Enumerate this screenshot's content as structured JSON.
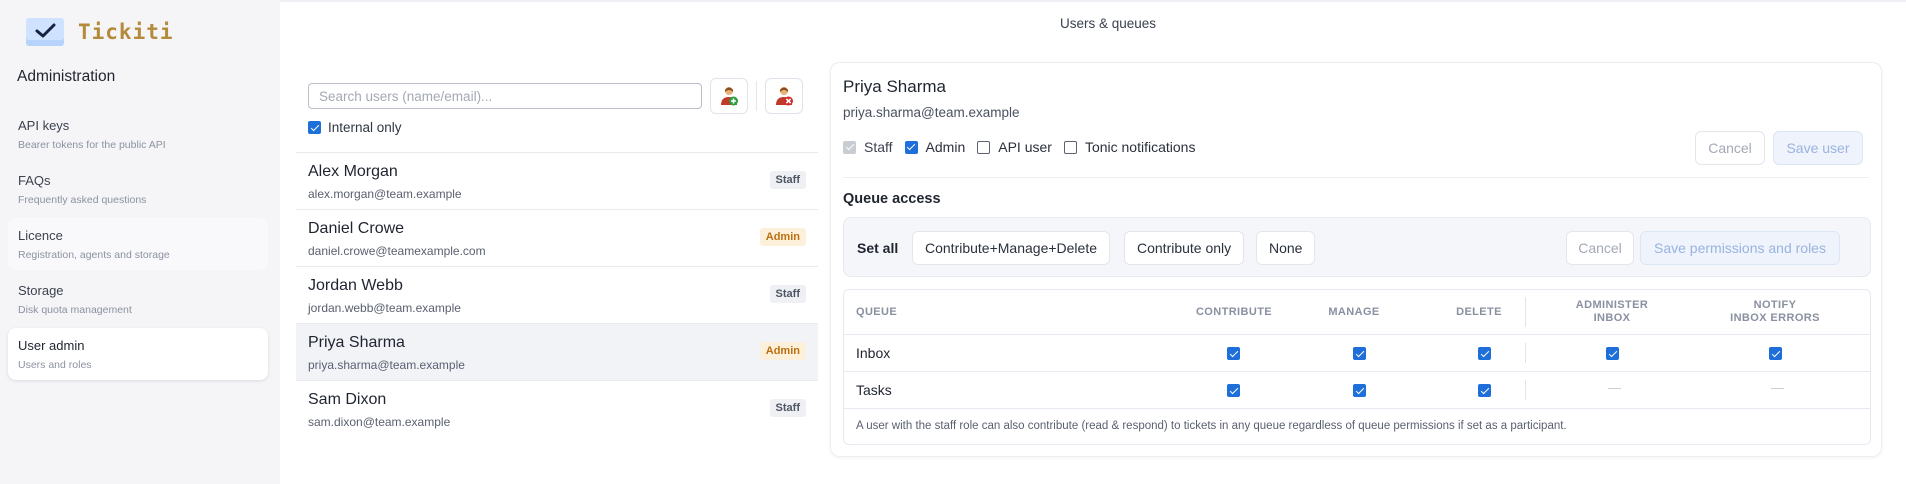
{
  "app": {
    "name": "Tickiti",
    "section": "Administration"
  },
  "header": {
    "title": "Users & queues"
  },
  "sidebar": {
    "items": [
      {
        "label": "API keys",
        "desc": "Bearer tokens for the public API"
      },
      {
        "label": "FAQs",
        "desc": "Frequently asked questions"
      },
      {
        "label": "Licence",
        "desc": "Registration, agents and storage"
      },
      {
        "label": "Storage",
        "desc": "Disk quota management"
      },
      {
        "label": "User admin",
        "desc": "Users and roles"
      }
    ]
  },
  "users": {
    "search_placeholder": "Search users (name/email)...",
    "search_value": "",
    "internal_only_label": "Internal only",
    "internal_only_checked": true,
    "list": [
      {
        "name": "Alex Morgan",
        "email": "alex.morgan@team.example",
        "badge": "Staff"
      },
      {
        "name": "Daniel Crowe",
        "email": "daniel.crowe@teamexample.com",
        "badge": "Admin"
      },
      {
        "name": "Jordan Webb",
        "email": "jordan.webb@team.example",
        "badge": "Staff"
      },
      {
        "name": "Priya Sharma",
        "email": "priya.sharma@team.example",
        "badge": "Admin"
      },
      {
        "name": "Sam Dixon",
        "email": "sam.dixon@team.example",
        "badge": "Staff"
      }
    ]
  },
  "detail": {
    "name": "Priya Sharma",
    "email": "priya.sharma@team.example",
    "roles": [
      {
        "label": "Staff",
        "state": "disabled-checked"
      },
      {
        "label": "Admin",
        "state": "checked"
      },
      {
        "label": "API user",
        "state": "unchecked"
      },
      {
        "label": "Tonic notifications",
        "state": "unchecked"
      }
    ],
    "cancel_label": "Cancel",
    "save_label": "Save user",
    "queue_access_title": "Queue access",
    "set_all_label": "Set all",
    "preset_cmd": "Contribute+Manage+Delete",
    "preset_contribute": "Contribute only",
    "preset_none": "None",
    "perm_cancel_label": "Cancel",
    "perm_save_label": "Save permissions and roles",
    "table": {
      "headers": {
        "queue": "QUEUE",
        "contribute": "CONTRIBUTE",
        "manage": "MANAGE",
        "delete": "DELETE",
        "administer_1": "ADMINISTER",
        "administer_2": "INBOX",
        "notify_1": "NOTIFY",
        "notify_2": "INBOX ERRORS"
      },
      "rows": [
        {
          "queue": "Inbox",
          "contribute": true,
          "manage": true,
          "delete": true,
          "administer": true,
          "notify": true
        },
        {
          "queue": "Tasks",
          "contribute": true,
          "manage": true,
          "delete": true,
          "administer": "—",
          "notify": "—"
        }
      ],
      "note": "A user with the staff role can also contribute (read & respond) to tickets in any queue regardless of queue permissions if set as a participant."
    }
  },
  "colors": {
    "accent": "#1e6fd9",
    "brand_text": "#b48a3b",
    "admin_badge_bg": "#fdf0da",
    "admin_badge_text": "#bc6f10",
    "staff_badge_bg": "#eef0f4"
  }
}
